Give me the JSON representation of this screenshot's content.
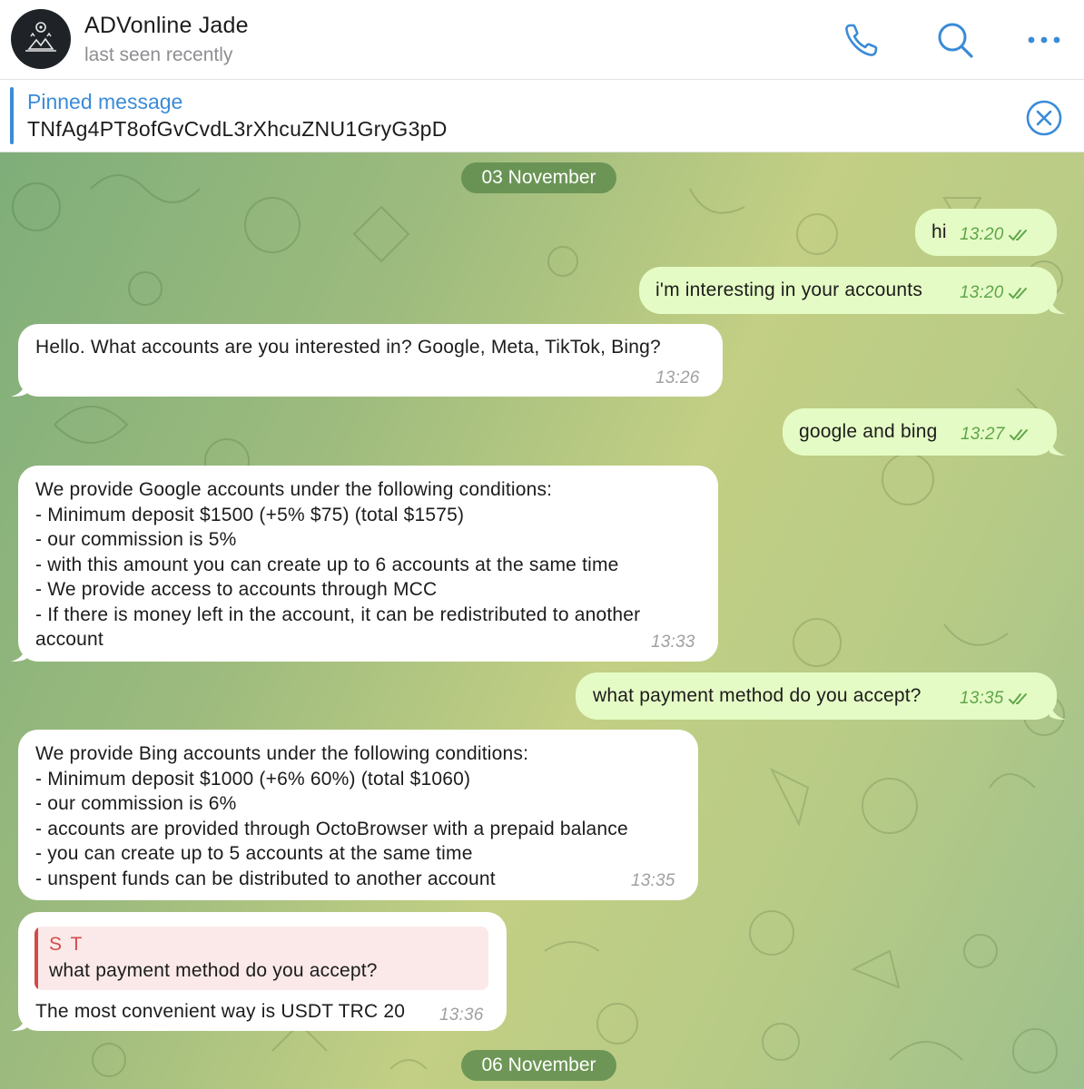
{
  "header": {
    "title": "ADVonline Jade",
    "status": "last seen recently"
  },
  "pinned": {
    "title": "Pinned message",
    "text": "TNfAg4PT8ofGvCvdL3rXhcuZNU1GryG3pD"
  },
  "dates": [
    "03 November",
    "06 November"
  ],
  "messages": [
    {
      "dir": "out",
      "text": "hi",
      "time": "13:20"
    },
    {
      "dir": "out",
      "text": "i'm interesting in your accounts",
      "time": "13:20"
    },
    {
      "dir": "in",
      "text": "Hello. What accounts are you interested in? Google, Meta, TikTok, Bing?",
      "time": "13:26"
    },
    {
      "dir": "out",
      "text": "google and bing",
      "time": "13:27"
    },
    {
      "dir": "in",
      "text": "We provide Google accounts under the following conditions:\n- Minimum deposit $1500 (+5% $75) (total $1575)\n- our commission is 5%\n- with this amount you can create up to 6 accounts at the same time\n- We provide access to accounts through MCC\n- If there is money left in the account, it can be redistributed to another\naccount",
      "time": "13:33"
    },
    {
      "dir": "out",
      "text": "what payment method do you accept?",
      "time": "13:35"
    },
    {
      "dir": "in",
      "text": "We provide Bing accounts under the following conditions:\n- Minimum deposit $1000 (+6% 60%) (total $1060)\n- our commission is 6%\n- accounts are provided through OctoBrowser with a prepaid balance\n- you can create up to 5 accounts at the same time\n- unspent funds can be distributed to another account",
      "time": "13:35"
    },
    {
      "dir": "in",
      "reply_author": "S T",
      "reply_text": "what payment method do you accept?",
      "text": "The most convenient way is USDT TRC 20",
      "time": "13:36"
    }
  ],
  "colors": {
    "accent": "#3a8bd8",
    "outgoing_bubble": "#e5fbc5",
    "incoming_bubble": "#ffffff",
    "outgoing_meta": "#5ea64a",
    "reply_accent": "#d34a4a"
  },
  "icons": [
    "phone-icon",
    "search-icon",
    "more-icon",
    "close-circle-icon",
    "double-check-icon"
  ]
}
